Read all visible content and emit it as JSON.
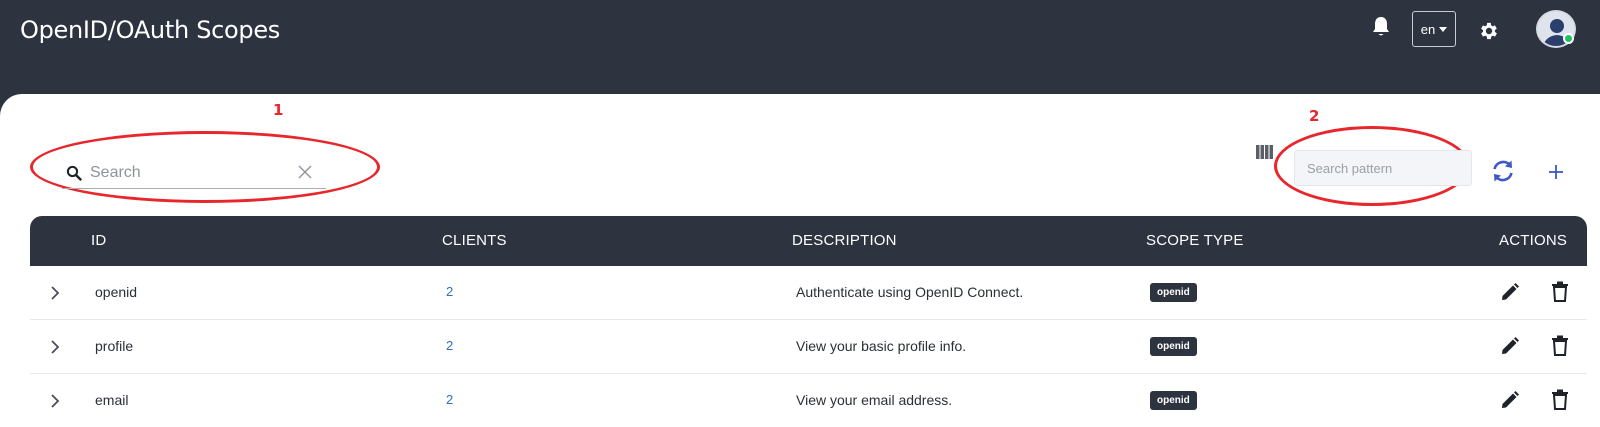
{
  "header": {
    "title": "OpenID/OAuth Scopes",
    "language": "en",
    "icons": [
      "bell-icon",
      "gear-icon",
      "avatar"
    ]
  },
  "annotations": {
    "first": "1",
    "second": "2"
  },
  "search": {
    "placeholder": "Search",
    "value": ""
  },
  "pattern_search": {
    "placeholder": "Search pattern",
    "value": ""
  },
  "table": {
    "headers": {
      "id": "ID",
      "clients": "CLIENTS",
      "description": "DESCRIPTION",
      "scope_type": "SCOPE TYPE",
      "actions": "ACTIONS"
    },
    "rows": [
      {
        "id": "openid",
        "clients": "2",
        "description": "Authenticate using OpenID Connect.",
        "scope_type": "openid"
      },
      {
        "id": "profile",
        "clients": "2",
        "description": "View your basic profile info.",
        "scope_type": "openid"
      },
      {
        "id": "email",
        "clients": "2",
        "description": "View your email address.",
        "scope_type": "openid"
      }
    ]
  },
  "colors": {
    "header_bg": "#2e3340",
    "annotation": "#e8262b",
    "link": "#2f6fbf",
    "accent": "#3b57c9"
  }
}
